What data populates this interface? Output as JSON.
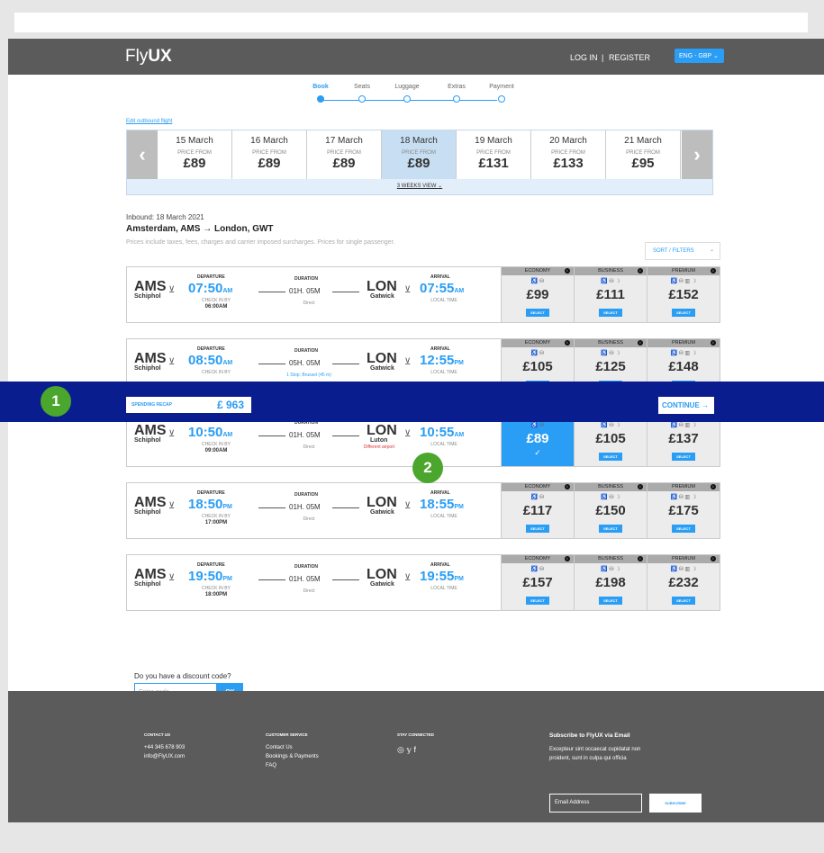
{
  "header": {
    "logo_prefix": "Fly",
    "logo_suffix": "UX",
    "login": "LOG IN",
    "sep": "|",
    "register": "REGISTER",
    "lang": "ENG - GBP",
    "lang_chevron": "⌄"
  },
  "steps": [
    "Book",
    "Seats",
    "Luggage",
    "Extras",
    "Payment"
  ],
  "edit_link": "Edit outbound flight",
  "dates": [
    {
      "d": "15 March",
      "pf": "PRICE FROM",
      "p": "£89"
    },
    {
      "d": "16 March",
      "pf": "PRICE FROM",
      "p": "£89"
    },
    {
      "d": "17 March",
      "pf": "PRICE FROM",
      "p": "£89"
    },
    {
      "d": "18 March",
      "pf": "PRICE FROM",
      "p": "£89"
    },
    {
      "d": "19 March",
      "pf": "PRICE FROM",
      "p": "£131"
    },
    {
      "d": "20 March",
      "pf": "PRICE FROM",
      "p": "£133"
    },
    {
      "d": "21 March",
      "pf": "PRICE FROM",
      "p": "£95"
    }
  ],
  "weeks_view": "3 WEEKS VIEW",
  "inbound": "Inbound: 18 March 2021",
  "route": "Amsterdam, AMS → London, GWT",
  "note": "Prices include taxes, fees, charges and carrier imposed surcharges. Prices for single passenger.",
  "sort": "SORT / FILTERS",
  "fare_labels": [
    "ECONOMY",
    "BUSINESS",
    "PREMIUM"
  ],
  "fare_icons": [
    "♿ ⛁",
    "♿ ⛁ ☽",
    "♿ ⛁ ▥ ☽"
  ],
  "select": "SELECT",
  "check": "✓",
  "labels": {
    "departure": "DEPARTURE",
    "duration": "DURATION",
    "arrival": "ARRIVAL",
    "checkin": "CHECK IN BY",
    "local": "LOCAL TIME"
  },
  "flights": [
    {
      "from": "AMS",
      "fromCity": "Schiphol",
      "dep": "07:50",
      "depAP": "AM",
      "checkin": "06:00AM",
      "dur": "01H. 05M",
      "stops": "Direct",
      "to": "LON",
      "toCity": "Gatwick",
      "arr": "07:55",
      "arrAP": "AM",
      "prices": [
        "£99",
        "£111",
        "£152"
      ]
    },
    {
      "from": "AMS",
      "fromCity": "Schiphol",
      "dep": "08:50",
      "depAP": "AM",
      "checkin": "",
      "dur": "05H. 05M",
      "stops": "1 Stop: Brussel (45 m)",
      "to": "LON",
      "toCity": "Gatwick",
      "arr": "12:55",
      "arrAP": "PM",
      "prices": [
        "£105",
        "£125",
        "£148"
      ]
    },
    {
      "from": "AMS",
      "fromCity": "Schiphol",
      "dep": "10:50",
      "depAP": "AM",
      "checkin": "09:00AM",
      "dur": "01H. 05M",
      "stops": "Direct",
      "to": "LON",
      "toCity": "Luton",
      "toNote": "Different airport",
      "arr": "10:55",
      "arrAP": "AM",
      "prices": [
        "£89",
        "£105",
        "£137"
      ]
    },
    {
      "from": "AMS",
      "fromCity": "Schiphol",
      "dep": "18:50",
      "depAP": "PM",
      "checkin": "17:00PM",
      "dur": "01H. 05M",
      "stops": "Direct",
      "to": "LON",
      "toCity": "Gatwick",
      "arr": "18:55",
      "arrAP": "PM",
      "prices": [
        "£117",
        "£150",
        "£175"
      ]
    },
    {
      "from": "AMS",
      "fromCity": "Schiphol",
      "dep": "19:50",
      "depAP": "PM",
      "checkin": "18:00PM",
      "dur": "01H. 05M",
      "stops": "Direct",
      "to": "LON",
      "toCity": "Gatwick",
      "arr": "19:55",
      "arrAP": "PM",
      "prices": [
        "£157",
        "£198",
        "£232"
      ]
    }
  ],
  "recap": {
    "label": "SPENDING RECAP",
    "amount": "£ 963",
    "continue": "CONTINUE →"
  },
  "badges": [
    "1",
    "2"
  ],
  "discount": {
    "question": "Do you have a discount code?",
    "placeholder": "Enter code",
    "ok": "OK"
  },
  "footer": {
    "contact_h": "CONTACT US",
    "phone": "+44 345 678 903",
    "mail": "info@FlyUX.com",
    "cs_h": "CUSTOMER SERVICE",
    "cs": [
      "Contact Us",
      "Bookings & Payments",
      "FAQ"
    ],
    "stay_h": "STAY CONNECTED",
    "social": "◎  𝕪  f",
    "sub_h": "Subscribe to FlyUX via Email",
    "sub_text1": "Excepteur sint occaecat cupidatat non",
    "sub_text2": "proident, sunt in culpa qui officia",
    "email_ph": "Email Address",
    "subscribe": "SUBSCRIBE"
  },
  "colors": {
    "accent": "#2a9df4",
    "band": "#0a1d8f",
    "badge": "#4aa62c",
    "header": "#5b5b5b"
  }
}
